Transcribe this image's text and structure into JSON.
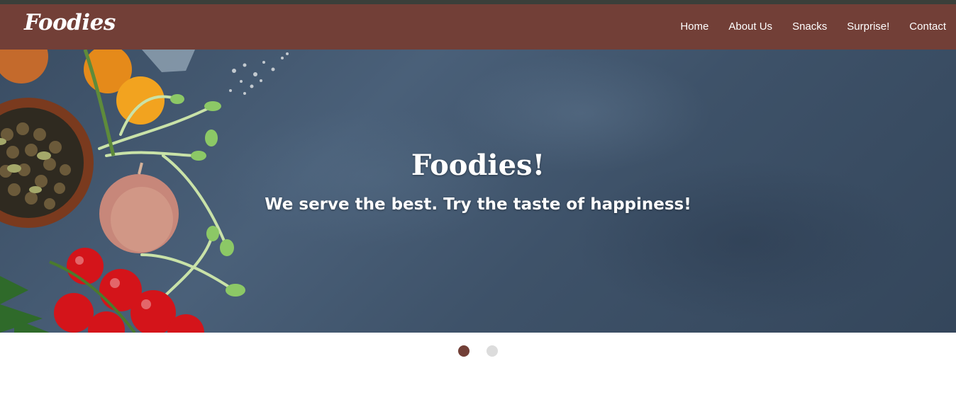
{
  "brand": {
    "name": "Foodies"
  },
  "nav": {
    "items": [
      {
        "label": "Home"
      },
      {
        "label": "About Us"
      },
      {
        "label": "Snacks"
      },
      {
        "label": "Surprise!"
      },
      {
        "label": "Contact"
      }
    ]
  },
  "hero": {
    "title": "Foodies!",
    "subtitle": "We serve the best. Try the taste of happiness!"
  },
  "carousel": {
    "slide_count": 2,
    "active_index": 0
  },
  "colors": {
    "accent": "#723f37",
    "inactive_dot": "#dcdcdc"
  }
}
